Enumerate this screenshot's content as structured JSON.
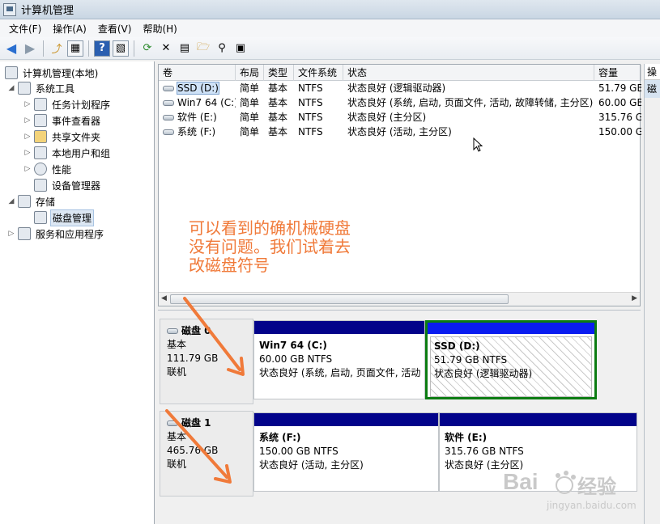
{
  "window": {
    "title": "计算机管理"
  },
  "menu": [
    "文件(F)",
    "操作(A)",
    "查看(V)",
    "帮助(H)"
  ],
  "toolbar_icons": [
    "back-icon",
    "forward-icon",
    "up-icon",
    "show-hide-tree-icon",
    "help-icon",
    "show-hide-action-icon",
    "refresh-icon",
    "delete-icon",
    "properties-icon",
    "open-icon",
    "search-icon",
    "disk-icon"
  ],
  "tree": {
    "root": "计算机管理(本地)",
    "system_tools": "系统工具",
    "task_scheduler": "任务计划程序",
    "event_viewer": "事件查看器",
    "shared_folders": "共享文件夹",
    "local_users": "本地用户和组",
    "performance": "性能",
    "device_manager": "设备管理器",
    "storage": "存储",
    "disk_management": "磁盘管理",
    "services_apps": "服务和应用程序"
  },
  "volume_list": {
    "headers": [
      "卷",
      "布局",
      "类型",
      "文件系统",
      "状态",
      "容量"
    ],
    "rows": [
      {
        "volume": "SSD (D:)",
        "layout": "简单",
        "type": "基本",
        "fs": "NTFS",
        "status": "状态良好 (逻辑驱动器)",
        "capacity": "51.79 GB"
      },
      {
        "volume": "Win7 64 (C:)",
        "layout": "简单",
        "type": "基本",
        "fs": "NTFS",
        "status": "状态良好 (系统, 启动, 页面文件, 活动, 故障转储, 主分区)",
        "capacity": "60.00 GB"
      },
      {
        "volume": "软件 (E:)",
        "layout": "简单",
        "type": "基本",
        "fs": "NTFS",
        "status": "状态良好 (主分区)",
        "capacity": "315.76 G"
      },
      {
        "volume": "系统 (F:)",
        "layout": "简单",
        "type": "基本",
        "fs": "NTFS",
        "status": "状态良好 (活动, 主分区)",
        "capacity": "150.00 G"
      }
    ]
  },
  "disks": [
    {
      "name": "磁盘 0",
      "type": "基本",
      "size": "111.79 GB",
      "state": "联机",
      "partitions": [
        {
          "name": "Win7 64  (C:)",
          "size": "60.00 GB NTFS",
          "status": "状态良好 (系统, 启动, 页面文件, 活动"
        },
        {
          "name": "SSD  (D:)",
          "size": "51.79 GB NTFS",
          "status": "状态良好 (逻辑驱动器)"
        }
      ]
    },
    {
      "name": "磁盘 1",
      "type": "基本",
      "size": "465.76 GB",
      "state": "联机",
      "partitions": [
        {
          "name": "系统  (F:)",
          "size": "150.00 GB NTFS",
          "status": "状态良好 (活动, 主分区)"
        },
        {
          "name": "软件  (E:)",
          "size": "315.76 GB NTFS",
          "status": "状态良好 (主分区)"
        }
      ]
    }
  ],
  "actions": {
    "header": "操",
    "item": "磁"
  },
  "annotation": "可以看到的确机械硬盘没有问题。我们试着去改磁盘符号",
  "watermark": {
    "brand": "Bai",
    "brand2": "经验",
    "url": "jingyan.baidu.com"
  },
  "colors": {
    "partition_bar": "#02038a",
    "logical_bar": "#0a1cf0",
    "selection_border": "#0c7c12",
    "annotation": "#f07a3a"
  }
}
